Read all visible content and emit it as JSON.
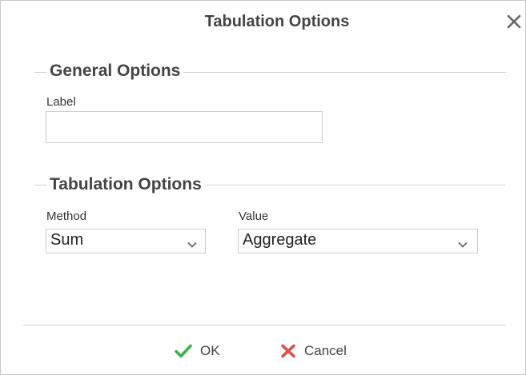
{
  "dialog": {
    "title": "Tabulation Options",
    "close_icon": "close-icon"
  },
  "general": {
    "section_title": "General Options",
    "label_field": {
      "label": "Label",
      "value": "",
      "placeholder": ""
    }
  },
  "tabulation": {
    "section_title": "Tabulation Options",
    "method": {
      "label": "Method",
      "selected": "Sum"
    },
    "value": {
      "label": "Value",
      "selected": "Aggregate"
    }
  },
  "footer": {
    "ok_label": "OK",
    "ok_icon": "checkmark-icon",
    "ok_color": "#3bb34a",
    "cancel_label": "Cancel",
    "cancel_icon": "x-icon",
    "cancel_color": "#d9534f"
  }
}
